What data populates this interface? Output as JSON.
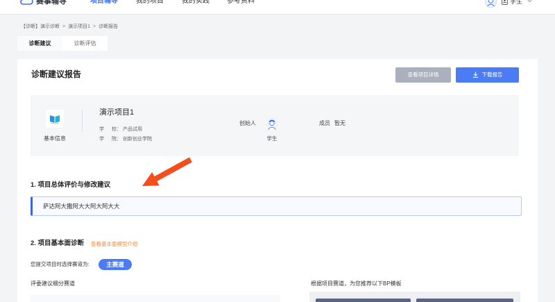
{
  "nav": {
    "logo_text": "赛事辅导",
    "items": [
      {
        "label": "项目辅导",
        "active": true
      },
      {
        "label": "我的项目"
      },
      {
        "label": "我的实践"
      },
      {
        "label": "参考资料"
      }
    ],
    "user_label": "学生"
  },
  "breadcrumb": {
    "items": [
      "【诊断】演示诊断",
      "演示项目1",
      "诊断报告"
    ],
    "separator": ">"
  },
  "tabs": [
    {
      "label": "诊断建议",
      "active": true
    },
    {
      "label": "诊断评估"
    }
  ],
  "report": {
    "title": "诊断建议报告",
    "view_details_label": "查看项目详情",
    "download_label": "下载报告"
  },
  "basic_info": {
    "label": "基本信息",
    "project_name": "演示项目1",
    "school_label": "学 校：",
    "school": "产品试用",
    "college_label": "学 院：",
    "college": "创新创业学院",
    "founder_label": "创始人",
    "founder_name": "学生",
    "members_label": "成员",
    "members_value": "暂无"
  },
  "section1": {
    "heading": "1. 项目总体评价与修改建议",
    "comment": "萨达阿大撒阿大大阿大阿大大"
  },
  "section2": {
    "heading": "2. 项目基本面诊断",
    "model_link": "查看基本面模型介绍",
    "track_prompt": "您提交项目时选择赛道为:",
    "track_value": "主赛道",
    "judge_suggest_label": "评委建议细分赛道",
    "bp_template_label": "根据项目赛道，为您推荐以下BP模板"
  },
  "icons": {
    "logo": "cloud-logo-icon",
    "user_avatar": "avatar-icon",
    "user_card": "id-card-icon",
    "dropdown": "chevron-down-icon",
    "download": "download-icon",
    "basic_info": "book-icon",
    "founder": "avatar-icon"
  },
  "colors": {
    "accent": "#3b6ef0",
    "button_gray": "#aab1bc",
    "button_blue": "#4b7cf3",
    "link_orange": "#f08a3c",
    "annotation_arrow": "#f24e1e"
  }
}
